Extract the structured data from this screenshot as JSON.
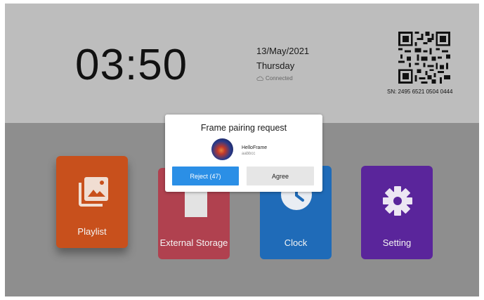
{
  "header": {
    "time": "03:50",
    "date": "13/May/2021",
    "weekday": "Thursday",
    "connection_status": "Connected",
    "connection_icon": "cloud-icon",
    "serial": "SN: 2495 6521 0504 0444"
  },
  "tiles": [
    {
      "label": "Playlist",
      "icon": "gallery-icon",
      "color": "#c8501c"
    },
    {
      "label": "External Storage",
      "icon": "sd-card-icon",
      "color": "#b0414f"
    },
    {
      "label": "Clock",
      "icon": "clock-icon",
      "color": "#1f6bb8"
    },
    {
      "label": "Setting",
      "icon": "gear-icon",
      "color": "#5a259b"
    }
  ],
  "dialog": {
    "title": "Frame pairing request",
    "device_name": "HelloFrame",
    "device_id": "aabbcc",
    "reject_label": "Reject (47)",
    "agree_label": "Agree"
  },
  "colors": {
    "reject_button": "#2b8fe6",
    "background_top": "#bdbdbd",
    "background_bottom": "#8e8e8e"
  }
}
